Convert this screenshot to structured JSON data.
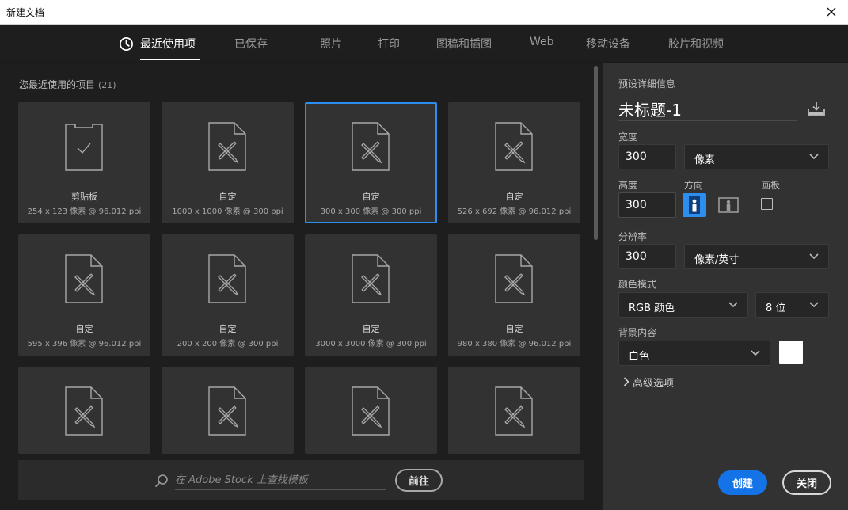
{
  "window": {
    "title": "新建文档"
  },
  "tabs": [
    {
      "label": "最近使用项",
      "active": true
    },
    {
      "label": "已保存"
    },
    {
      "label": "照片"
    },
    {
      "label": "打印"
    },
    {
      "label": "图稿和插图"
    },
    {
      "label": "Web"
    },
    {
      "label": "移动设备"
    },
    {
      "label": "胶片和视频"
    }
  ],
  "recent": {
    "title": "您最近使用的项目",
    "count": "(21)",
    "items": [
      {
        "name": "剪贴板",
        "desc": "254 x 123 像素 @ 96.012 ppi",
        "icon": "clipboard-icon"
      },
      {
        "name": "自定",
        "desc": "1000 x 1000 像素 @ 300 ppi",
        "icon": "custom-document-icon"
      },
      {
        "name": "自定",
        "desc": "300 x 300 像素 @ 300 ppi",
        "icon": "custom-document-icon",
        "selected": true
      },
      {
        "name": "自定",
        "desc": "526 x 692 像素 @ 96.012 ppi",
        "icon": "custom-document-icon"
      },
      {
        "name": "自定",
        "desc": "595 x 396 像素 @ 96.012 ppi",
        "icon": "custom-document-icon"
      },
      {
        "name": "自定",
        "desc": "200 x 200 像素 @ 300 ppi",
        "icon": "custom-document-icon"
      },
      {
        "name": "自定",
        "desc": "3000 x 3000 像素 @ 300 ppi",
        "icon": "custom-document-icon"
      },
      {
        "name": "自定",
        "desc": "980 x 380 像素 @ 96.012 ppi",
        "icon": "custom-document-icon"
      }
    ]
  },
  "stock": {
    "placeholder": "在 Adobe Stock 上查找模板",
    "go_label": "前往"
  },
  "preset": {
    "section_label": "预设详细信息",
    "doc_name": "未标题-1",
    "width_label": "宽度",
    "width_value": "300",
    "width_unit": "像素",
    "height_label": "高度",
    "height_value": "300",
    "orientation_label": "方向",
    "artboard_label": "画板",
    "resolution_label": "分辨率",
    "resolution_value": "300",
    "resolution_unit": "像素/英寸",
    "color_mode_label": "颜色模式",
    "color_mode": "RGB 颜色",
    "bit_depth": "8 位",
    "background_label": "背景内容",
    "background": "白色",
    "advanced_label": "高级选项"
  },
  "buttons": {
    "create": "创建",
    "close": "关闭"
  },
  "colors": {
    "accent": "#1473e6",
    "selected_border": "#2c8ff0",
    "background_swatch": "#ffffff"
  }
}
